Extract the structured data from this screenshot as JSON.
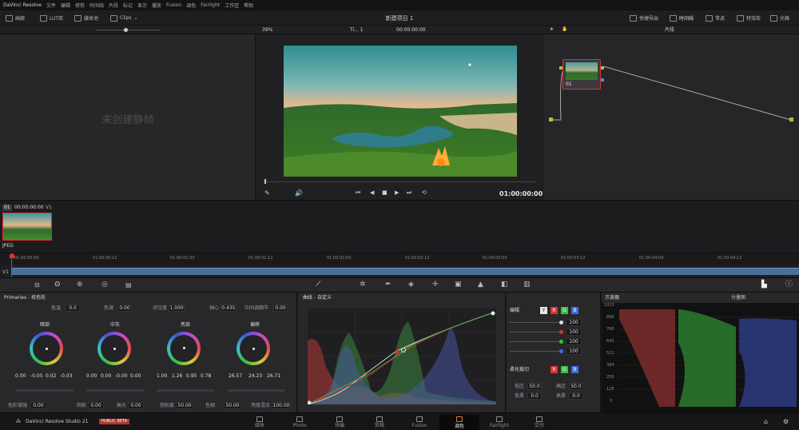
{
  "menubar": {
    "app": "DaVinci Resolve",
    "items": [
      "文件",
      "编辑",
      "修剪",
      "时间线",
      "片段",
      "标记",
      "显示",
      "播放",
      "Fusion",
      "调色",
      "Fairlight",
      "工作区",
      "帮助"
    ]
  },
  "toolbar": {
    "gallery": "画廊",
    "lut": "LUT库",
    "media": "媒体池",
    "clips": "Clips",
    "project_title": "新建项目 1",
    "quick_export": "快捷导出",
    "timeline": "时间线",
    "nodes": "节点",
    "effects": "特效库",
    "lightbox": "光箱"
  },
  "viewer": {
    "zoom": "39%",
    "timeline_name": "Ti... 1",
    "timecode_top": "00:00:00:00",
    "timecode": "01:00:00:00"
  },
  "gallery": {
    "empty_text": "未创建静帧"
  },
  "nodes": {
    "mode": "片段",
    "node_label": "01"
  },
  "clip": {
    "index": "01",
    "timecode": "00:00:00:00",
    "track": "V1",
    "format": "JPEG"
  },
  "timeline": {
    "ticks": [
      "01:00:00:00",
      "01:00:00:12",
      "01:00:01:00",
      "01:00:01:12",
      "01:00:02:00",
      "01:00:02:12",
      "01:00:03:00",
      "01:00:03:12",
      "01:00:04:00",
      "01:00:04:12"
    ],
    "track": "V1"
  },
  "primaries": {
    "title": "Primaries - 校色轮",
    "temp_label": "色温",
    "temp": "0.0",
    "tint_label": "色调",
    "tint": "0.00",
    "contrast_label": "对比度",
    "contrast": "1.000",
    "pivot_label": "轴心",
    "pivot": "0.435",
    "middetail_label": "中间调细节",
    "middetail": "0.00",
    "wheels": [
      {
        "name": "暗部",
        "vals": [
          "0.00",
          "-0.05",
          "0.02",
          "-0.03"
        ]
      },
      {
        "name": "中灰",
        "vals": [
          "0.00",
          "0.00",
          "-0.00",
          "0.00"
        ]
      },
      {
        "name": "亮部",
        "vals": [
          "1.00",
          "1.26",
          "0.95",
          "0.78"
        ]
      },
      {
        "name": "偏移",
        "vals": [
          "26.57",
          "24.23",
          "26.71"
        ]
      }
    ],
    "colorboost_label": "色彩增强",
    "colorboost": "0.00",
    "shadows_label": "阴影",
    "shadows": "0.00",
    "highlights_label": "高光",
    "highlights": "0.00",
    "sat_label": "饱和度",
    "sat": "50.00",
    "hue_label": "色相",
    "hue": "50.00",
    "lummix_label": "亮度混合",
    "lummix": "100.00"
  },
  "curves": {
    "title": "曲线 - 自定义"
  },
  "channels": {
    "edit_label": "编辑",
    "values": [
      "100",
      "100",
      "100",
      "100"
    ],
    "soft_label": "柔化裁切",
    "low_label": "低区",
    "low": "50.0",
    "high_label": "高区",
    "high": "50.0",
    "lowsoft_label": "低柔",
    "lowsoft": "0.0",
    "highsoft_label": "高柔",
    "highsoft": "0.0",
    "ybtn": "Y",
    "rbtn": "R",
    "gbtn": "G",
    "bbtn": "B"
  },
  "scopes": {
    "title": "示波器",
    "mode": "分量图",
    "scale": [
      "1023",
      "896",
      "768",
      "640",
      "512",
      "384",
      "256",
      "128",
      "0"
    ]
  },
  "pagebar": {
    "product": "DaVinci Resolve Studio 21",
    "badge": "PUBLIC BETA",
    "pages": [
      "媒体",
      "Photo",
      "快编",
      "剪辑",
      "Fusion",
      "调色",
      "Fairlight",
      "交付"
    ],
    "active": "调色"
  },
  "colors": {
    "accent_red": "#e03030",
    "node_green": "#9bc93c",
    "active_page_bg": "#0a0a0b"
  }
}
